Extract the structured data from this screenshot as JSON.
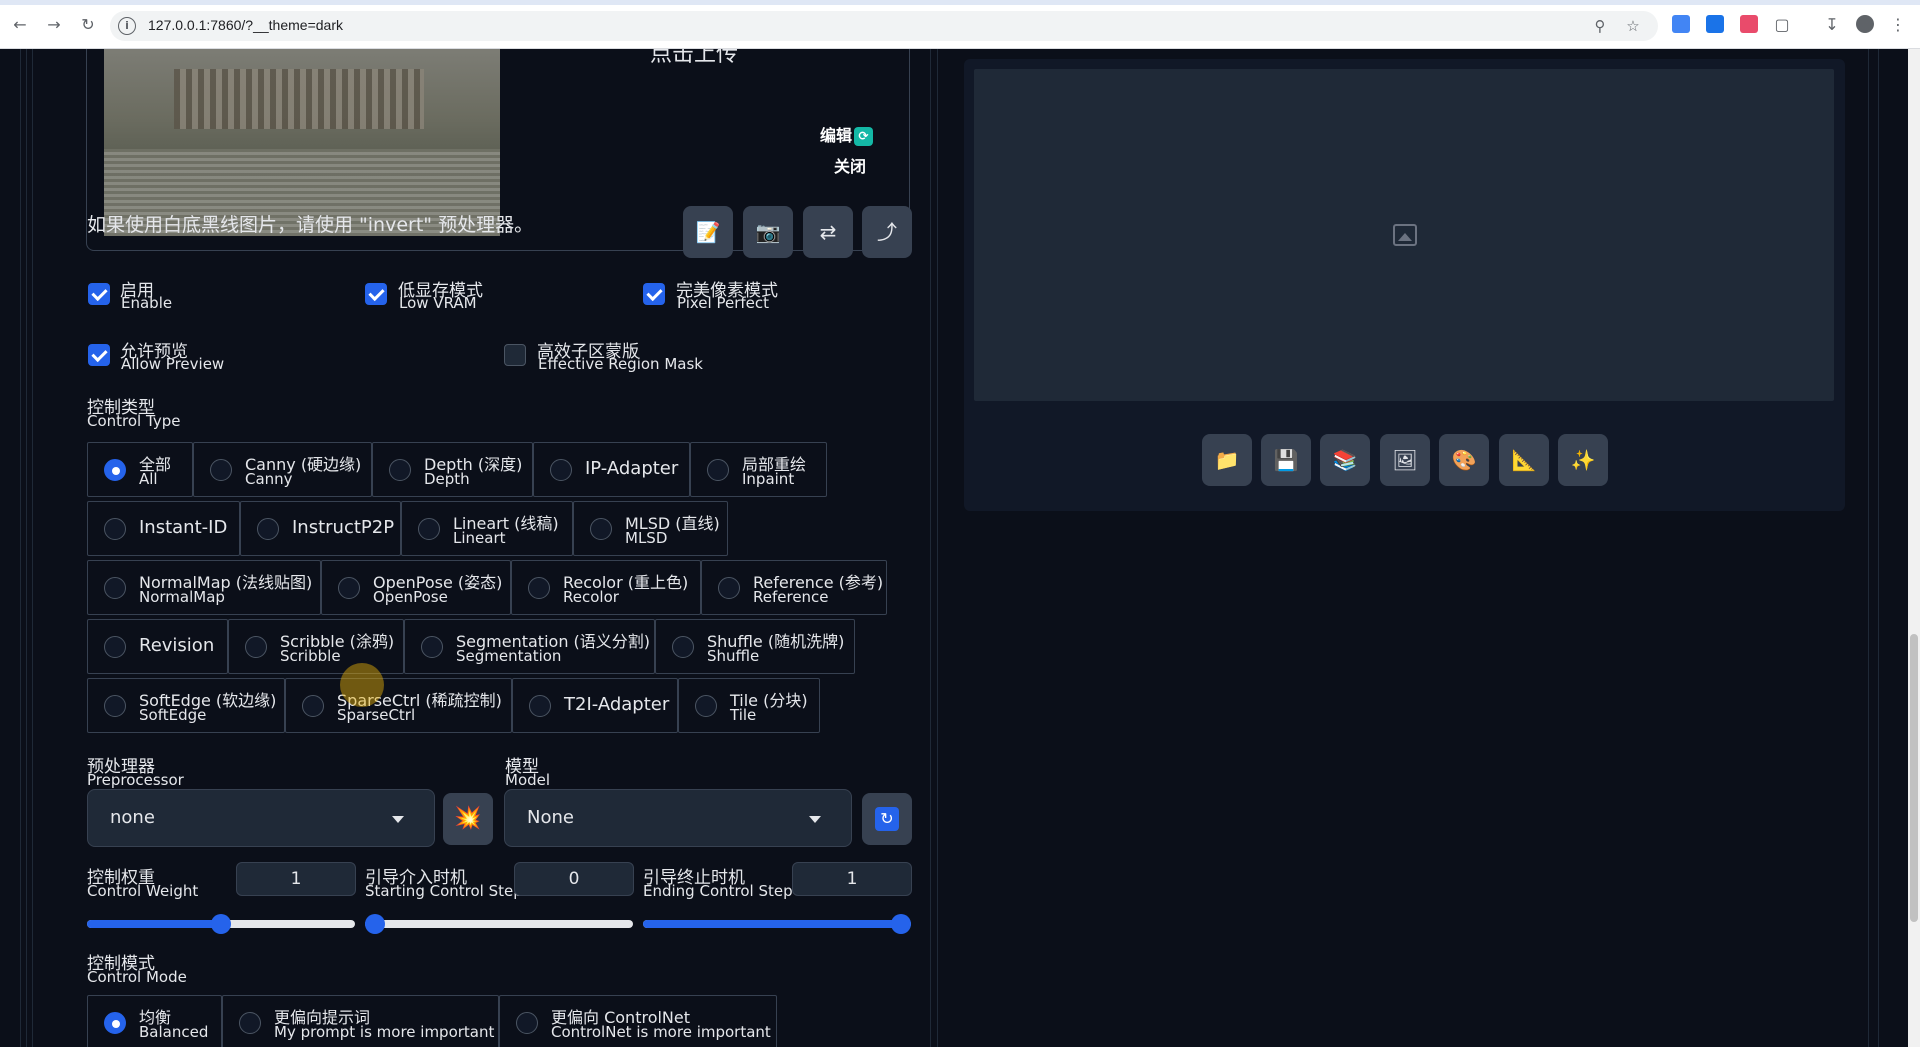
{
  "browser": {
    "url": "127.0.0.1:7860/?__theme=dark",
    "back_icon": "arrow-left",
    "forward_icon": "arrow-right",
    "reload_icon": "reload"
  },
  "upload": {
    "click_upload": "点击上传",
    "edit_label": "编辑",
    "close_label": "关闭"
  },
  "hint_text": "如果使用白底黑线图片，请使用 \"invert\" 预处理器。",
  "tools": [
    "notepad-icon",
    "camera-icon",
    "swap-icon",
    "send-icon"
  ],
  "checkboxes": [
    {
      "zh": "启用",
      "en": "Enable",
      "checked": true
    },
    {
      "zh": "低显存模式",
      "en": "Low VRAM",
      "checked": true
    },
    {
      "zh": "完美像素模式",
      "en": "Pixel Perfect",
      "checked": true
    },
    {
      "zh": "允许预览",
      "en": "Allow Preview",
      "checked": true
    },
    {
      "zh": "高效子区蒙版",
      "en": "Effective Region Mask",
      "checked": false
    }
  ],
  "control_type": {
    "zh": "控制类型",
    "en": "Control Type",
    "options": [
      {
        "zh": "全部",
        "en": "All",
        "selected": true
      },
      {
        "zh": "Canny (硬边缘)",
        "en": "Canny"
      },
      {
        "zh": "Depth (深度)",
        "en": "Depth"
      },
      {
        "single": "IP-Adapter"
      },
      {
        "zh": "局部重绘",
        "en": "Inpaint"
      },
      {
        "single": "Instant-ID"
      },
      {
        "single": "InstructP2P"
      },
      {
        "zh": "Lineart (线稿)",
        "en": "Lineart"
      },
      {
        "zh": "MLSD (直线)",
        "en": "MLSD"
      },
      {
        "zh": "NormalMap (法线贴图)",
        "en": "NormalMap"
      },
      {
        "zh": "OpenPose (姿态)",
        "en": "OpenPose"
      },
      {
        "zh": "Recolor (重上色)",
        "en": "Recolor"
      },
      {
        "zh": "Reference (参考)",
        "en": "Reference"
      },
      {
        "single": "Revision"
      },
      {
        "zh": "Scribble (涂鸦)",
        "en": "Scribble"
      },
      {
        "zh": "Segmentation (语义分割)",
        "en": "Segmentation"
      },
      {
        "zh": "Shuffle (随机洗牌)",
        "en": "Shuffle"
      },
      {
        "zh": "SoftEdge (软边缘)",
        "en": "SoftEdge"
      },
      {
        "zh": "SparseCtrl (稀疏控制)",
        "en": "SparseCtrl"
      },
      {
        "single": "T2I-Adapter"
      },
      {
        "zh": "Tile (分块)",
        "en": "Tile"
      }
    ]
  },
  "preprocessor": {
    "zh": "预处理器",
    "en": "Preprocessor",
    "value": "none"
  },
  "model": {
    "zh": "模型",
    "en": "Model",
    "value": "None"
  },
  "weights": [
    {
      "zh": "控制权重",
      "en": "Control Weight",
      "value": "1",
      "fraction": 0.5
    },
    {
      "zh": "引导介入时机",
      "en": "Starting Control Step",
      "value": "0",
      "fraction": 0.0
    },
    {
      "zh": "引导终止时机",
      "en": "Ending Control Step",
      "value": "1",
      "fraction": 1.0
    }
  ],
  "control_mode": {
    "zh": "控制模式",
    "en": "Control Mode",
    "options": [
      {
        "zh": "均衡",
        "en": "Balanced",
        "selected": true
      },
      {
        "zh": "更偏向提示词",
        "en": "My prompt is more important"
      },
      {
        "zh": "更偏向 ControlNet",
        "en": "ControlNet is more important"
      }
    ]
  },
  "right_tools": [
    "folder-icon",
    "save-icon",
    "layers-icon",
    "image-icon",
    "palette-icon",
    "ruler-icon",
    "sparkle-icon"
  ]
}
